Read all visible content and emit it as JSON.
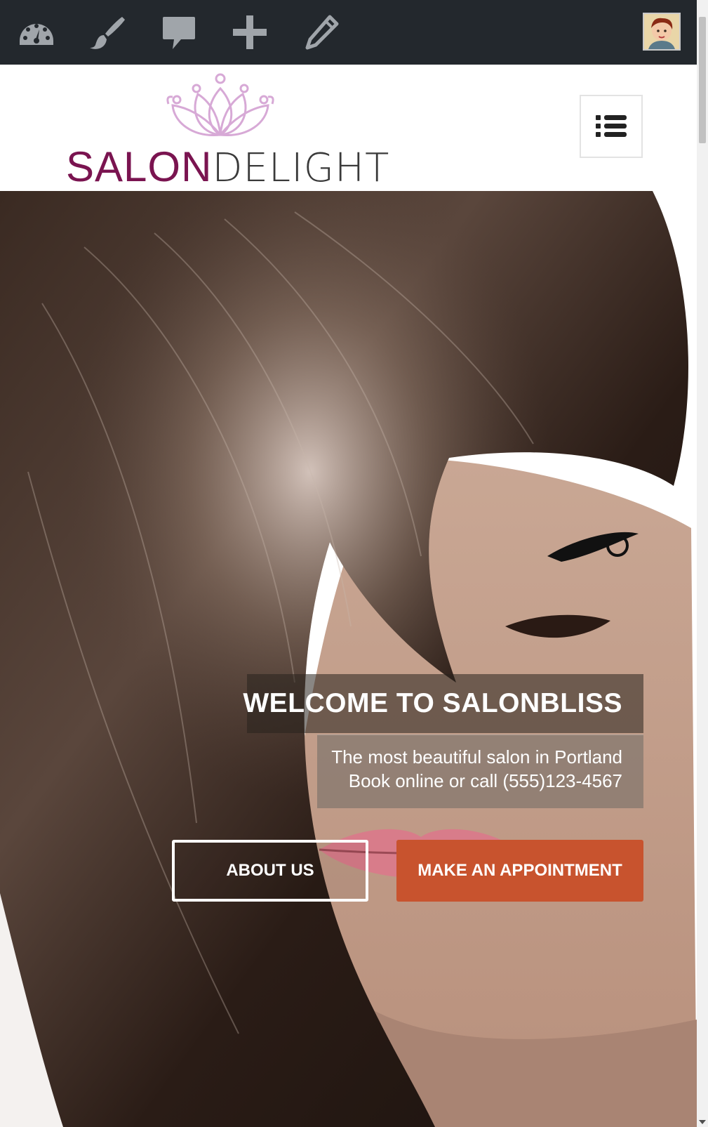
{
  "admin_bar": {
    "icons": [
      "dashboard-icon",
      "customize-brush-icon",
      "comments-icon",
      "new-plus-icon",
      "edit-pencil-icon"
    ],
    "avatar": "user-avatar"
  },
  "header": {
    "logo": {
      "word1": "SALON",
      "word2": "DELIGHT"
    },
    "menu_icon": "menu-list-icon"
  },
  "hero": {
    "title": "WELCOME TO SALONBLISS",
    "subtitle_line1": "The most beautiful salon in Portland",
    "subtitle_line2": "Book online or call (555)123-4567",
    "about_button": "ABOUT US",
    "appointment_button": "MAKE AN APPOINTMENT"
  },
  "colors": {
    "admin_bar_bg": "#23282d",
    "admin_icon": "#a0a5aa",
    "logo_primary": "#7a1450",
    "logo_secondary": "#3a3a3a",
    "logo_flower": "#d7a9d6",
    "appointment_button": "#c8532e"
  }
}
